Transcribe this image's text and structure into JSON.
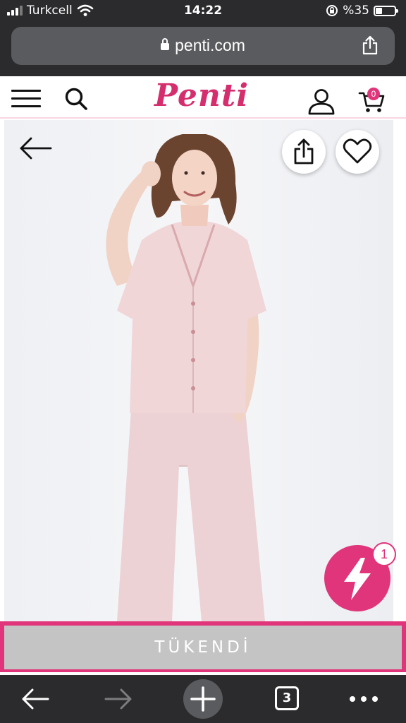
{
  "status_bar": {
    "carrier": "Turkcell",
    "time": "14:22",
    "battery_percent": "%35",
    "battery_level": 0.35
  },
  "browser": {
    "url": "penti.com",
    "open_tabs": "3"
  },
  "site": {
    "logo_text": "Penti",
    "cart_count": "0",
    "brand_color": "#d52e6e"
  },
  "product": {
    "flash_badge_count": "1",
    "sold_out_label": "TÜKENDİ"
  },
  "icons": {
    "menu": "hamburger-icon",
    "search": "search-icon",
    "user": "user-icon",
    "cart": "cart-icon",
    "back": "arrow-left-icon",
    "share": "share-icon",
    "favorite": "heart-icon",
    "flash": "lightning-icon"
  }
}
